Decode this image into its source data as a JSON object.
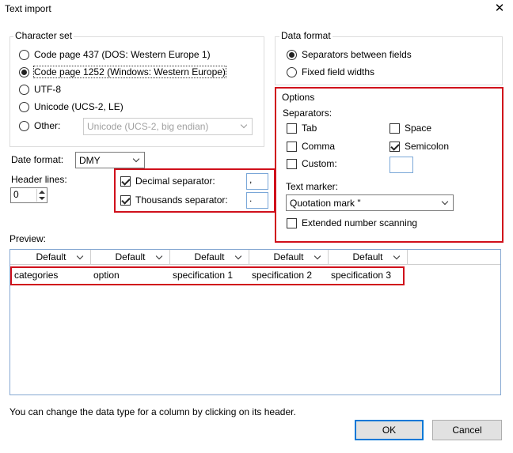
{
  "window": {
    "title": "Text import"
  },
  "character_set": {
    "legend": "Character set",
    "options": [
      {
        "label": "Code page 437 (DOS: Western Europe 1)",
        "selected": false
      },
      {
        "label": "Code page 1252 (Windows: Western Europe)",
        "selected": true
      },
      {
        "label": "UTF-8",
        "selected": false
      },
      {
        "label": "Unicode (UCS-2, LE)",
        "selected": false
      },
      {
        "label": "Other:",
        "selected": false
      }
    ],
    "other_value": "Unicode (UCS-2, big endian)"
  },
  "date_format": {
    "label": "Date format:",
    "value": "DMY"
  },
  "header_lines": {
    "label": "Header lines:",
    "value": "0"
  },
  "decimal_separator": {
    "label": "Decimal separator:",
    "checked": true,
    "value": ","
  },
  "thousands_separator": {
    "label": "Thousands separator:",
    "checked": true,
    "value": "."
  },
  "data_format": {
    "legend": "Data format",
    "options": [
      {
        "label": "Separators between fields",
        "selected": true
      },
      {
        "label": "Fixed field widths",
        "selected": false
      }
    ]
  },
  "options": {
    "legend": "Options",
    "separators_label": "Separators:",
    "tab": {
      "label": "Tab",
      "checked": false
    },
    "space": {
      "label": "Space",
      "checked": false
    },
    "comma": {
      "label": "Comma",
      "checked": false
    },
    "semicolon": {
      "label": "Semicolon",
      "checked": true
    },
    "custom": {
      "label": "Custom:",
      "checked": false,
      "value": ""
    },
    "text_marker_label": "Text marker:",
    "text_marker_value": "Quotation mark \"",
    "extended": {
      "label": "Extended number scanning",
      "checked": false
    }
  },
  "preview": {
    "label": "Preview:",
    "columns": [
      "Default",
      "Default",
      "Default",
      "Default",
      "Default"
    ],
    "row": [
      "categories",
      "option",
      "specification 1",
      "specification 2",
      "specification 3"
    ]
  },
  "hint": "You can change the data type for a column by clicking on its header.",
  "buttons": {
    "ok": "OK",
    "cancel": "Cancel"
  },
  "colors": {
    "highlight": "#d0101b",
    "accent": "#0078d7"
  }
}
